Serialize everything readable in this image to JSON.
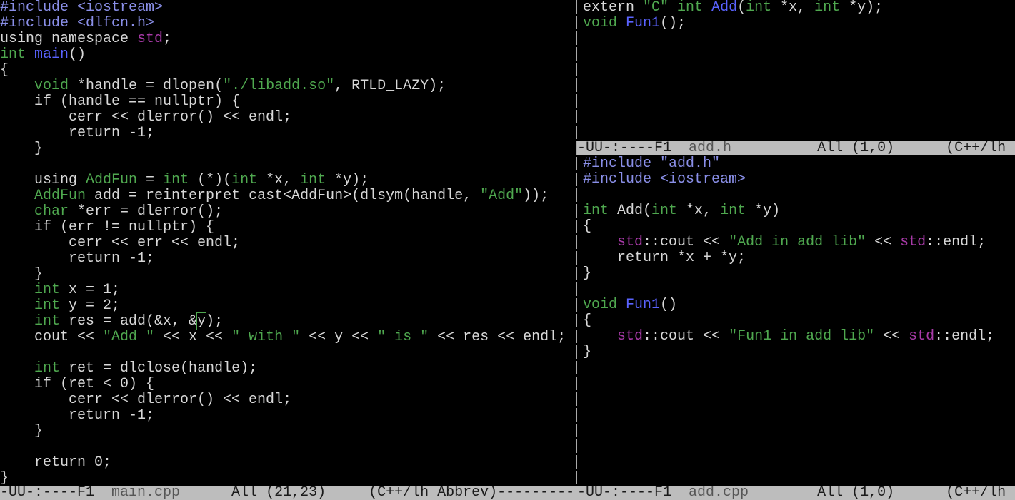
{
  "left_pane": {
    "lines": [
      [
        {
          "t": "#include <iostream>",
          "c": "p"
        }
      ],
      [
        {
          "t": "#include <dlfcn.h>",
          "c": "p"
        }
      ],
      [
        {
          "t": "using namespace ",
          "c": "x"
        },
        {
          "t": "std",
          "c": "n"
        },
        {
          "t": ";",
          "c": "x"
        }
      ],
      [
        {
          "t": "int ",
          "c": "t"
        },
        {
          "t": "main",
          "c": "f"
        },
        {
          "t": "()",
          "c": "x"
        }
      ],
      [
        {
          "t": "{",
          "c": "x"
        }
      ],
      [
        {
          "t": "    ",
          "c": "x"
        },
        {
          "t": "void",
          "c": "t"
        },
        {
          "t": " *handle = dlopen(",
          "c": "x"
        },
        {
          "t": "\"./libadd.so\"",
          "c": "s"
        },
        {
          "t": ", RTLD_LAZY);",
          "c": "x"
        }
      ],
      [
        {
          "t": "    if (handle == nullptr) {",
          "c": "x"
        }
      ],
      [
        {
          "t": "        cerr << dlerror() << endl;",
          "c": "x"
        }
      ],
      [
        {
          "t": "        return -1;",
          "c": "x"
        }
      ],
      [
        {
          "t": "    }",
          "c": "x"
        }
      ],
      [
        {
          "t": "",
          "c": "x"
        }
      ],
      [
        {
          "t": "    using ",
          "c": "x"
        },
        {
          "t": "AddFun",
          "c": "t"
        },
        {
          "t": " = ",
          "c": "x"
        },
        {
          "t": "int",
          "c": "t"
        },
        {
          "t": " (*)(",
          "c": "x"
        },
        {
          "t": "int",
          "c": "t"
        },
        {
          "t": " *x, ",
          "c": "x"
        },
        {
          "t": "int",
          "c": "t"
        },
        {
          "t": " *y);",
          "c": "x"
        }
      ],
      [
        {
          "t": "    ",
          "c": "x"
        },
        {
          "t": "AddFun",
          "c": "t"
        },
        {
          "t": " add = reinterpret_cast<AddFun>(dlsym(handle, ",
          "c": "x"
        },
        {
          "t": "\"Add\"",
          "c": "s"
        },
        {
          "t": "));",
          "c": "x"
        }
      ],
      [
        {
          "t": "    ",
          "c": "x"
        },
        {
          "t": "char",
          "c": "t"
        },
        {
          "t": " *err = dlerror();",
          "c": "x"
        }
      ],
      [
        {
          "t": "    if (err != nullptr) {",
          "c": "x"
        }
      ],
      [
        {
          "t": "        cerr << err << endl;",
          "c": "x"
        }
      ],
      [
        {
          "t": "        return -1;",
          "c": "x"
        }
      ],
      [
        {
          "t": "    }",
          "c": "x"
        }
      ],
      [
        {
          "t": "    ",
          "c": "x"
        },
        {
          "t": "int",
          "c": "t"
        },
        {
          "t": " x = 1;",
          "c": "x"
        }
      ],
      [
        {
          "t": "    ",
          "c": "x"
        },
        {
          "t": "int",
          "c": "t"
        },
        {
          "t": " y = 2;",
          "c": "x"
        }
      ],
      [
        {
          "t": "    ",
          "c": "x"
        },
        {
          "t": "int",
          "c": "t"
        },
        {
          "t": " res = add(&x, &",
          "c": "x"
        },
        {
          "t": "y",
          "c": "cursor"
        },
        {
          "t": ");",
          "c": "x"
        }
      ],
      [
        {
          "t": "    cout << ",
          "c": "x"
        },
        {
          "t": "\"Add \"",
          "c": "s"
        },
        {
          "t": " << x << ",
          "c": "x"
        },
        {
          "t": "\" with \"",
          "c": "s"
        },
        {
          "t": " << y << ",
          "c": "x"
        },
        {
          "t": "\" is \"",
          "c": "s"
        },
        {
          "t": " << res << endl;",
          "c": "x"
        }
      ],
      [
        {
          "t": "",
          "c": "x"
        }
      ],
      [
        {
          "t": "    ",
          "c": "x"
        },
        {
          "t": "int",
          "c": "t"
        },
        {
          "t": " ret = dlclose(handle);",
          "c": "x"
        }
      ],
      [
        {
          "t": "    if (ret < 0) {",
          "c": "x"
        }
      ],
      [
        {
          "t": "        cerr << dlerror() << endl;",
          "c": "x"
        }
      ],
      [
        {
          "t": "        return -1;",
          "c": "x"
        }
      ],
      [
        {
          "t": "    }",
          "c": "x"
        }
      ],
      [
        {
          "t": "",
          "c": "x"
        }
      ],
      [
        {
          "t": "    return 0;",
          "c": "x"
        }
      ],
      [
        {
          "t": "}",
          "c": "x"
        }
      ]
    ],
    "modeline": {
      "prefix": "-UU-:----F1  ",
      "filename": "main.cpp",
      "rest": "      All (21,23)     (C++/lh Abbrev)---------"
    }
  },
  "top_right_pane": {
    "lines": [
      [
        {
          "t": "extern ",
          "c": "x"
        },
        {
          "t": "\"C\"",
          "c": "s"
        },
        {
          "t": " ",
          "c": "x"
        },
        {
          "t": "int",
          "c": "t"
        },
        {
          "t": " ",
          "c": "x"
        },
        {
          "t": "Add",
          "c": "f"
        },
        {
          "t": "(",
          "c": "x"
        },
        {
          "t": "int",
          "c": "t"
        },
        {
          "t": " *x, ",
          "c": "x"
        },
        {
          "t": "int",
          "c": "t"
        },
        {
          "t": " *y);",
          "c": "x"
        }
      ],
      [
        {
          "t": "void",
          "c": "t"
        },
        {
          "t": " ",
          "c": "x"
        },
        {
          "t": "Fun1",
          "c": "f"
        },
        {
          "t": "();",
          "c": "x"
        }
      ]
    ],
    "modeline": {
      "prefix": "-UU-:----F1  ",
      "filename": "add.h",
      "rest": "          All (1,0)      (C++/lh"
    }
  },
  "bottom_right_pane": {
    "lines": [
      [
        {
          "t": "#include \"add.h\"",
          "c": "p"
        }
      ],
      [
        {
          "t": "#include <iostream>",
          "c": "p"
        }
      ],
      [
        {
          "t": "",
          "c": "x"
        }
      ],
      [
        {
          "t": "int",
          "c": "t"
        },
        {
          "t": " Add(",
          "c": "x"
        },
        {
          "t": "int",
          "c": "t"
        },
        {
          "t": " *x, ",
          "c": "x"
        },
        {
          "t": "int",
          "c": "t"
        },
        {
          "t": " *y)",
          "c": "x"
        }
      ],
      [
        {
          "t": "{",
          "c": "x"
        }
      ],
      [
        {
          "t": "    ",
          "c": "x"
        },
        {
          "t": "std",
          "c": "n"
        },
        {
          "t": "::cout << ",
          "c": "x"
        },
        {
          "t": "\"Add in add lib\"",
          "c": "s"
        },
        {
          "t": " << ",
          "c": "x"
        },
        {
          "t": "std",
          "c": "n"
        },
        {
          "t": "::endl;",
          "c": "x"
        }
      ],
      [
        {
          "t": "    return *x + *y;",
          "c": "x"
        }
      ],
      [
        {
          "t": "}",
          "c": "x"
        }
      ],
      [
        {
          "t": "",
          "c": "x"
        }
      ],
      [
        {
          "t": "void",
          "c": "t"
        },
        {
          "t": " ",
          "c": "x"
        },
        {
          "t": "Fun1",
          "c": "f"
        },
        {
          "t": "()",
          "c": "x"
        }
      ],
      [
        {
          "t": "{",
          "c": "x"
        }
      ],
      [
        {
          "t": "    ",
          "c": "x"
        },
        {
          "t": "std",
          "c": "n"
        },
        {
          "t": "::cout << ",
          "c": "x"
        },
        {
          "t": "\"Fun1 in add lib\"",
          "c": "s"
        },
        {
          "t": " << ",
          "c": "x"
        },
        {
          "t": "std",
          "c": "n"
        },
        {
          "t": "::endl;",
          "c": "x"
        }
      ],
      [
        {
          "t": "}",
          "c": "x"
        }
      ]
    ],
    "modeline": {
      "prefix": "-UU-:----F1  ",
      "filename": "add.cpp",
      "rest": "        All (1,0)      (C++/lh"
    }
  },
  "colors": {
    "background": "#000000",
    "modeline_bg": "#bdbdbd",
    "preprocessor": "#8a8fe8",
    "type": "#4fa84f",
    "string": "#4fa84f",
    "function": "#5a63ff",
    "namespace": "#a83aa8"
  }
}
